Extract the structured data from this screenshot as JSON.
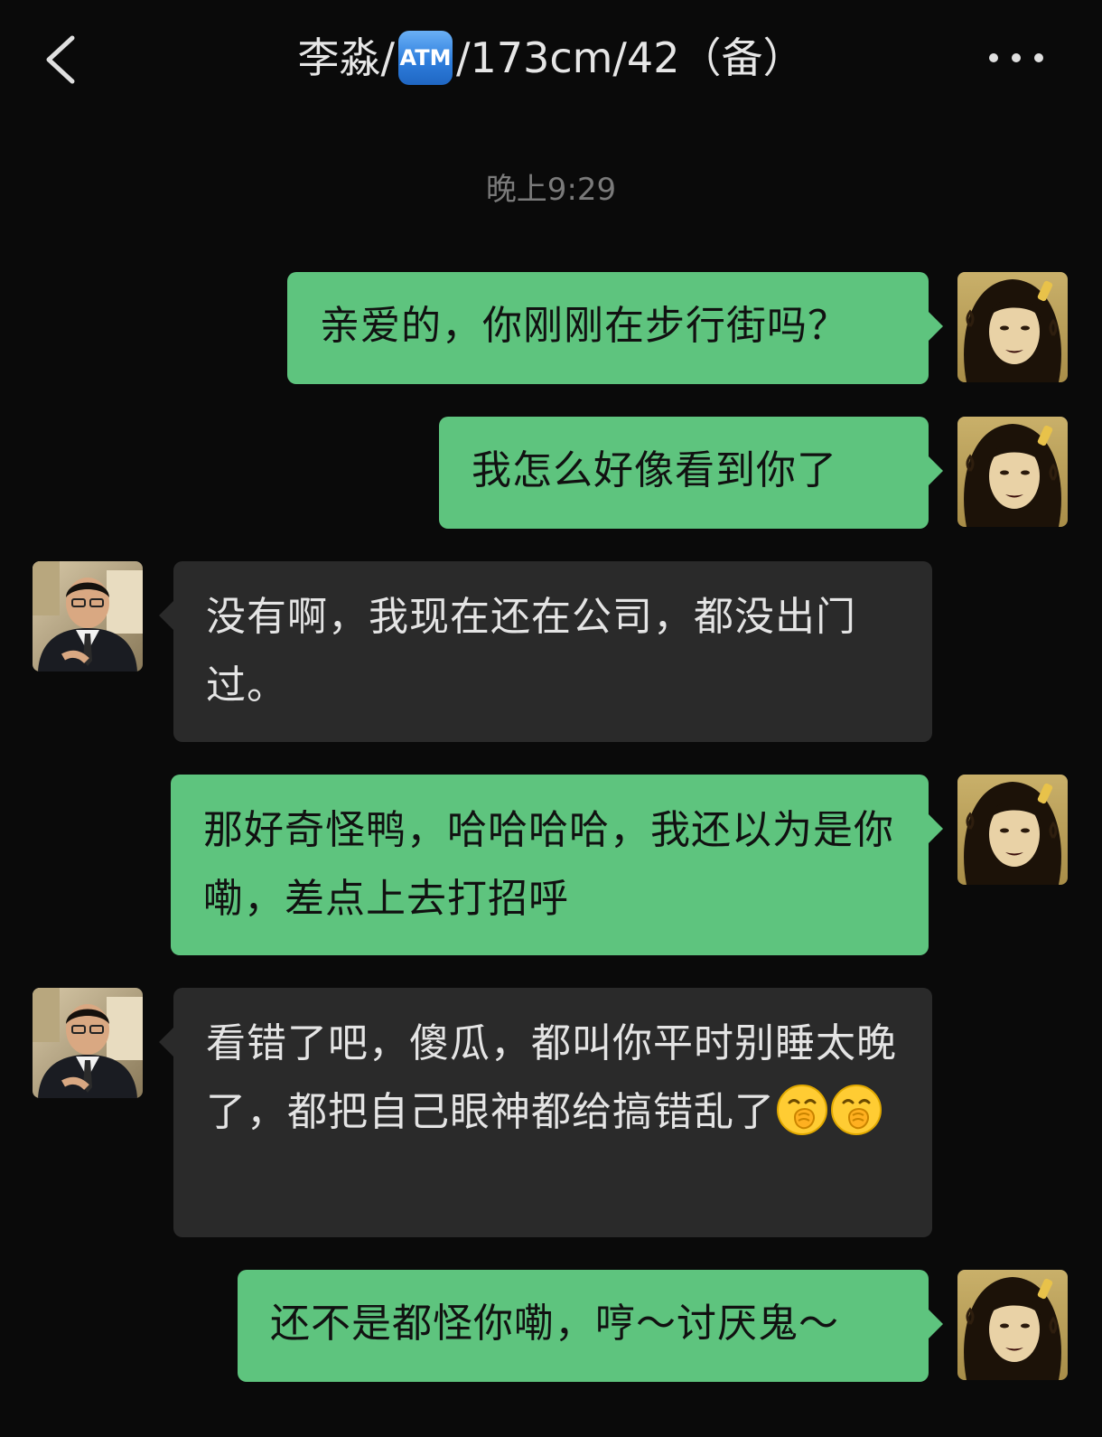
{
  "header": {
    "title_prefix": "李淼/",
    "title_badge": "ATM",
    "title_suffix": "/173cm/42（备）",
    "back_icon": "chevron-left-icon",
    "more_icon": "more-dots-icon"
  },
  "timestamp": "晚上9:29",
  "colors": {
    "sent_bubble": "#5ec47e",
    "recv_bubble": "#2a2a2a",
    "background": "#0a0a0a"
  },
  "messages": [
    {
      "side": "sent",
      "text": "亲爱的，你刚刚在步行街吗？"
    },
    {
      "side": "sent",
      "text": "我怎么好像看到你了"
    },
    {
      "side": "recv",
      "text": "没有啊，我现在还在公司，都没出门过。"
    },
    {
      "side": "sent",
      "text": "那好奇怪鸭，哈哈哈哈，我还以为是你嘞，差点上去打招呼"
    },
    {
      "side": "recv",
      "text": "看错了吧，傻瓜，都叫你平时别睡太晚了，都把自己眼神都给搞错乱了",
      "emoji": "face-with-hand-over-mouth-icon"
    },
    {
      "side": "sent",
      "text": "还不是都怪你嘞，哼～讨厌鬼～"
    }
  ]
}
